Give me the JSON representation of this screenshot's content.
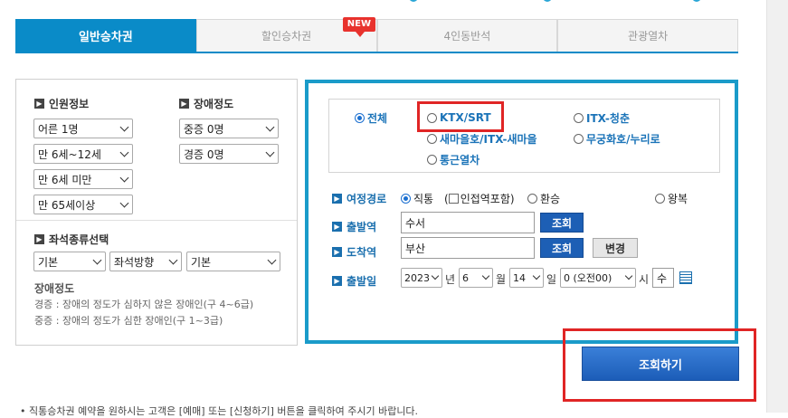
{
  "tabs": [
    {
      "label": "일반승차권",
      "active": true
    },
    {
      "label": "할인승차권",
      "active": false
    },
    {
      "label": "4인동반석",
      "active": false
    },
    {
      "label": "관광열차",
      "active": false
    }
  ],
  "new_badge": "NEW",
  "passengers": {
    "title": "인원정보",
    "adult": "어른 1명",
    "child": "만 6세~12세",
    "infant": "만 6세 미만",
    "senior": "만 65세이상"
  },
  "disability": {
    "title": "장애정도",
    "severe": "중증 0명",
    "mild": "경증 0명"
  },
  "seat": {
    "title": "좌석종류선택",
    "type": "기본",
    "direction": "좌석방향",
    "option": "기본"
  },
  "disability_note": {
    "title": "장애정도",
    "mild": "경증 : 장애의 정도가 심하지 않은 장애인(구 4~6급)",
    "severe": "중증 : 장애의 정도가 심한 장애인(구 1~3급)"
  },
  "train_types": {
    "all": "전체",
    "ktx": "KTX/SRT",
    "itx_cheongchun": "ITX-청춘",
    "saemaeul": "새마을호/ITX-새마을",
    "mugunghwa": "무궁화호/누리로",
    "commuter": "통근열차"
  },
  "route": {
    "label": "여정경로",
    "direct": "직통",
    "nearby": "인접역포함",
    "transfer": "환승",
    "round": "왕복"
  },
  "departure": {
    "label": "출발역",
    "value": "수서",
    "button": "조회"
  },
  "arrival": {
    "label": "도착역",
    "value": "부산",
    "button": "조회",
    "swap": "변경"
  },
  "date": {
    "label": "출발일",
    "year": "2023",
    "year_unit": "년",
    "month": "6",
    "month_unit": "월",
    "day": "14",
    "day_unit": "일",
    "time": "0 (오전00)",
    "time_unit": "시",
    "weekday": "수"
  },
  "search_button": "조회하기",
  "bottom_note": "• 직통승차권 예약을 원하시는 고객은 [예매] 또는 [신청하기] 버튼을 클릭하여 주시기 바랍니다."
}
